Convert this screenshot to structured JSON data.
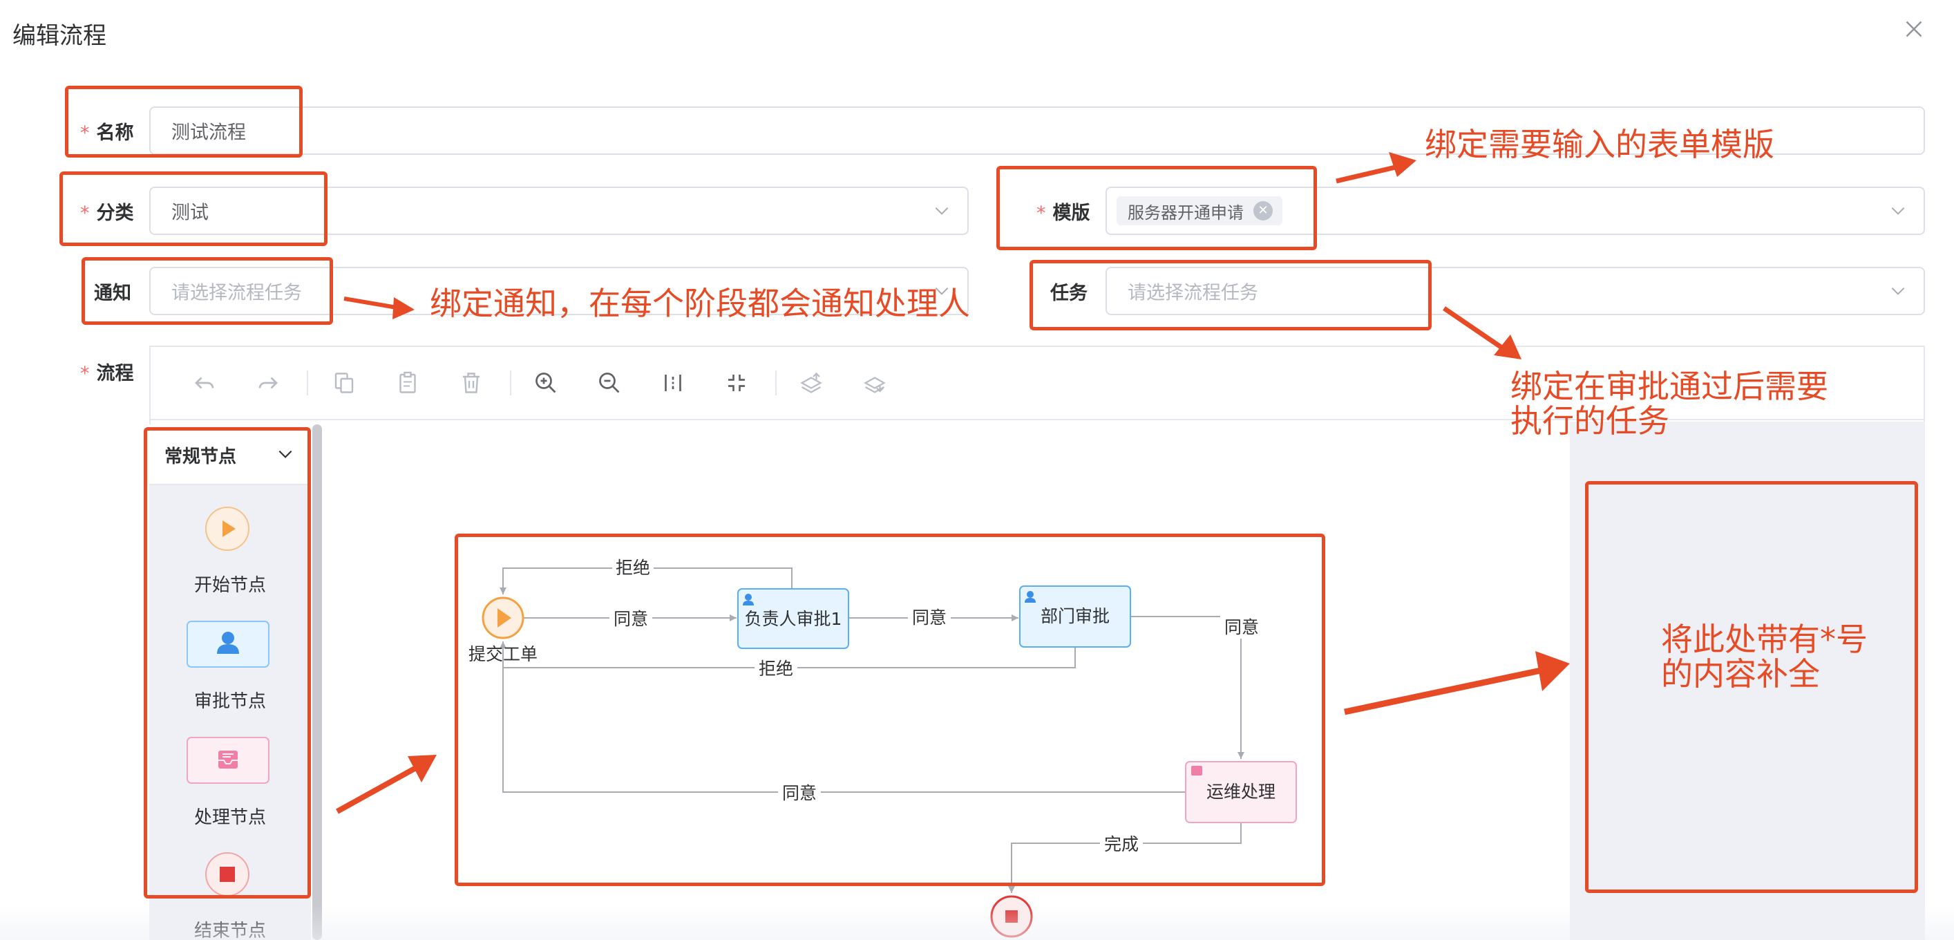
{
  "dialog": {
    "title": "编辑流程"
  },
  "form": {
    "name": {
      "label": "名称",
      "required": "*",
      "value": "测试流程"
    },
    "category": {
      "label": "分类",
      "required": "*",
      "value": "测试"
    },
    "template": {
      "label": "模版",
      "required": "*",
      "tag": "服务器开通申请"
    },
    "notify": {
      "label": "通知",
      "placeholder": "请选择流程任务"
    },
    "task": {
      "label": "任务",
      "placeholder": "请选择流程任务"
    },
    "flow": {
      "label": "流程",
      "required": "*"
    }
  },
  "toolbar": {
    "icons": [
      "undo-icon",
      "redo-icon",
      "copy-icon",
      "paste-icon",
      "delete-icon",
      "zoom-in-icon",
      "zoom-out-icon",
      "fit-icon",
      "actual-size-icon",
      "to-front-icon",
      "to-back-icon"
    ]
  },
  "palette": {
    "group_title": "常规节点",
    "items": [
      {
        "label": "开始节点",
        "icon": "play-icon"
      },
      {
        "label": "审批节点",
        "icon": "user-icon"
      },
      {
        "label": "处理节点",
        "icon": "inbox-icon"
      },
      {
        "label": "结束节点",
        "icon": "stop-icon"
      }
    ]
  },
  "flowchart": {
    "nodes": {
      "start": "提交工单",
      "owner_approve": "负责人审批1",
      "dept_approve": "部门审批",
      "ops_process": "运维处理"
    },
    "edges": {
      "reject_top": "拒绝",
      "agree_1": "同意",
      "agree_2": "同意",
      "agree_3": "同意",
      "reject_bottom": "拒绝",
      "agree_back": "同意",
      "complete": "完成"
    }
  },
  "annotations": {
    "template": "绑定需要输入的表单模版",
    "notify": "绑定通知，在每个阶段都会通知处理人",
    "task_line1": "绑定在审批通过后需要",
    "task_line2": "执行的任务",
    "props_line1": "将此处带有*号",
    "props_line2": "的内容补全"
  },
  "colors": {
    "annotation": "#e74b25",
    "start_node": "#f5a142",
    "approve_node_bg": "#e6f4ff",
    "approve_node_border": "#5aaef5",
    "process_node_bg": "#fdeef3",
    "process_node_border": "#f0a6c0",
    "end_node": "#e03c3c"
  }
}
